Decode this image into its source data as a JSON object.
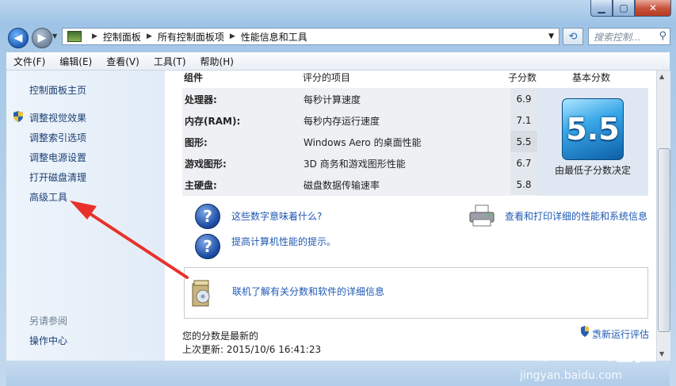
{
  "address": {
    "crumbs": [
      "控制面板",
      "所有控制面板项",
      "性能信息和工具"
    ],
    "search_placeholder": "搜索控制..."
  },
  "menu": [
    "文件(F)",
    "编辑(E)",
    "查看(V)",
    "工具(T)",
    "帮助(H)"
  ],
  "sidebar": {
    "home": "控制面板主页",
    "links": [
      "调整视觉效果",
      "调整索引选项",
      "调整电源设置",
      "打开磁盘清理",
      "高级工具"
    ],
    "see_also_title": "另请参阅",
    "see_also_links": [
      "操作中心"
    ]
  },
  "table": {
    "headers": {
      "component": "组件",
      "rated": "评分的项目",
      "subscore": "子分数",
      "base": "基本分数"
    },
    "rows": [
      {
        "component": "处理器:",
        "item": "每秒计算速度",
        "score": "6.9"
      },
      {
        "component": "内存(RAM):",
        "item": "每秒内存运行速度",
        "score": "7.1"
      },
      {
        "component": "图形:",
        "item": "Windows Aero 的桌面性能",
        "score": "5.5"
      },
      {
        "component": "游戏图形:",
        "item": "3D 商务和游戏图形性能",
        "score": "6.7"
      },
      {
        "component": "主硬盘:",
        "item": "磁盘数据传输速率",
        "score": "5.8"
      }
    ],
    "base_score": "5.5",
    "base_caption": "由最低子分数决定"
  },
  "links": {
    "what_mean": "这些数字意味着什么?",
    "tips": "提高计算机性能的提示。",
    "print": "查看和打印详细的性能和系统信息",
    "online": "联机了解有关分数和软件的详细信息"
  },
  "status": {
    "current": "您的分数是最新的",
    "last_update": "上次更新: 2015/10/6 16:41:23",
    "rerun": "重新运行评估"
  },
  "watermark": {
    "brand": "Bai",
    "brand2": "经验",
    "url": "jingyan.baidu.com"
  },
  "colors": {
    "link": "#1f58b4",
    "arrow": "#e8312a",
    "badge": "#1f7fd0"
  }
}
